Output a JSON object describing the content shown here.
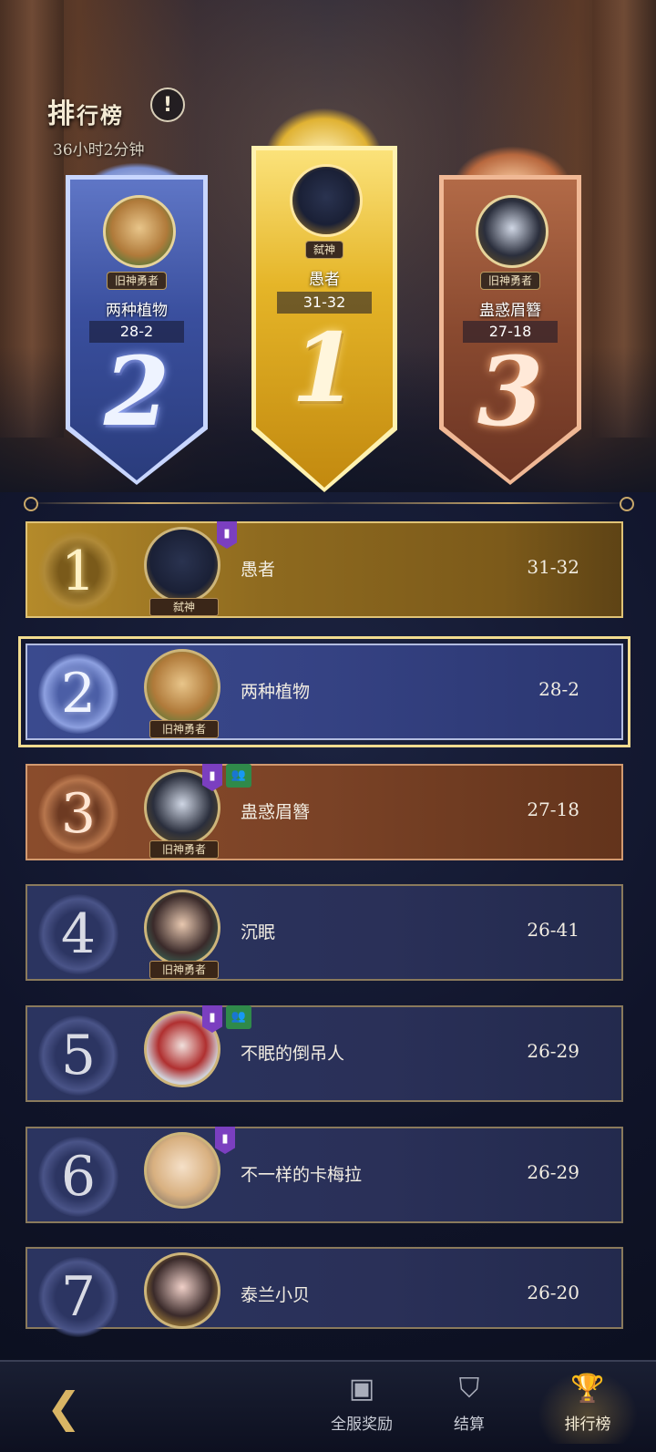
{
  "header": {
    "title_big": "排",
    "title_rest": "行榜",
    "info_icon": "!",
    "timer": "36小时2分钟"
  },
  "podium": [
    {
      "rank": "2",
      "name": "两种植物",
      "score": "28-2",
      "title": "旧神勇者",
      "avatar_icon": "hamster-avatar"
    },
    {
      "rank": "1",
      "name": "愚者",
      "score": "31-32",
      "title": "弑神",
      "avatar_icon": "crow-avatar"
    },
    {
      "rank": "3",
      "name": "蛊惑眉簪",
      "score": "27-18",
      "title": "旧神勇者",
      "avatar_icon": "dark-prince-avatar"
    }
  ],
  "list": [
    {
      "rank": "1",
      "name": "愚者",
      "score": "31-32",
      "title": "弑神"
    },
    {
      "rank": "2",
      "name": "两种植物",
      "score": "28-2",
      "title": "旧神勇者"
    },
    {
      "rank": "3",
      "name": "蛊惑眉簪",
      "score": "27-18",
      "title": "旧神勇者"
    },
    {
      "rank": "4",
      "name": "沉眠",
      "score": "26-41",
      "title": "旧神勇者"
    },
    {
      "rank": "5",
      "name": "不眠的倒吊人",
      "score": "26-29"
    },
    {
      "rank": "6",
      "name": "不一样的卡梅拉",
      "score": "26-29"
    },
    {
      "rank": "7",
      "name": "泰兰小贝",
      "score": "26-20"
    }
  ],
  "nav": {
    "home_icon": "back-arrow-icon",
    "items": [
      {
        "label": "全服奖励",
        "icon": "chest-icon"
      },
      {
        "label": "结算",
        "icon": "banner-icon"
      },
      {
        "label": "排行榜",
        "icon": "trophy-icon"
      }
    ]
  },
  "colors": {
    "gold": "#e5b528",
    "silver": "#3a4f9e",
    "bronze": "#8a4a30",
    "accent": "#f2dc8f"
  }
}
